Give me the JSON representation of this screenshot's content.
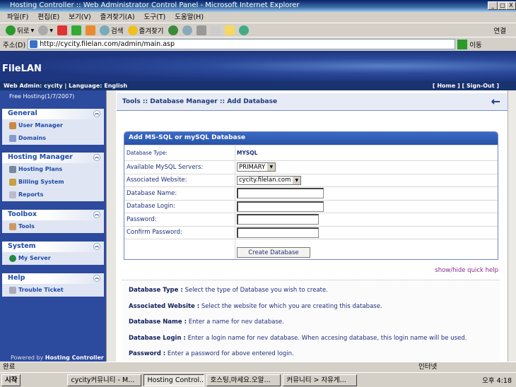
{
  "window": {
    "title": "Hosting Controller :: Web Administrator Control Panel - Microsoft Internet Explorer",
    "min": "_",
    "max": "□",
    "close": "X"
  },
  "menu": [
    "파일(F)",
    "편집(E)",
    "보기(V)",
    "즐겨찾기(A)",
    "도구(T)",
    "도움말(H)"
  ],
  "toolbar": {
    "back": "뒤로",
    "search": "검색",
    "favorites": "즐겨찾기",
    "links": "연결"
  },
  "address": {
    "label": "주소(D)",
    "url": "http://cycity.filelan.com/admin/main.asp",
    "go": "이동"
  },
  "banner": {
    "brand": "FileLAN",
    "user_info": "Web Admin: cycity | Language: English",
    "links": "[ Home ] [ Sign-Out ]"
  },
  "sidebar": {
    "plan": "Free Hosting(1/7/2007)",
    "footer_prefix": "Powered by",
    "footer_brand": "Hosting Controller",
    "sections": [
      {
        "title": "General",
        "items": [
          "User Manager",
          "Domains"
        ]
      },
      {
        "title": "Hosting Manager",
        "items": [
          "Hosting Plans",
          "Billing System",
          "Reports"
        ]
      },
      {
        "title": "Toolbox",
        "items": [
          "Tools"
        ]
      },
      {
        "title": "System",
        "items": [
          "My Server"
        ]
      },
      {
        "title": "Help",
        "items": [
          "Trouble Ticket"
        ]
      }
    ]
  },
  "main": {
    "breadcrumb": "Tools :: Database Manager :: Add Database",
    "back_arrow": "←",
    "form": {
      "title": "Add MS-SQL or mySQL Database",
      "db_type_label": "Database Type:",
      "db_type_value": "MYSQL",
      "servers_label": "Available MySQL Servers:",
      "servers_value": "PRIMARY",
      "website_label": "Associated Website:",
      "website_value": "cycity.filelan.com",
      "name_label": "Database Name:",
      "name_value": "",
      "login_label": "Database Login:",
      "login_value": "",
      "password_label": "Password:",
      "confirm_label": "Confirm Password:",
      "submit": "Create Database"
    },
    "quick_help_toggle": "show/hide quick help",
    "help": [
      {
        "term": "Database Type :",
        "text": "Select the type of Database you wish to create."
      },
      {
        "term": "Associated Website :",
        "text": "Select the website for which you are creating this database."
      },
      {
        "term": "Database Name :",
        "text": "Enter a name for nev database."
      },
      {
        "term": "Database Login :",
        "text": "Enter a login name for nev database. When accesing database, this login name will be used."
      },
      {
        "term": "Password :",
        "text": "Enter a password for above entered login."
      }
    ]
  },
  "status": {
    "text": "완료",
    "zone": "인터넷"
  },
  "taskbar": {
    "start": "시작",
    "tasks": [
      "cycity커뮤니티 - M...",
      "Hosting Control...",
      "호스팅,마세요.오알...",
      "커뮤니티 > 자유게..."
    ],
    "clock": "오후 4:18"
  }
}
